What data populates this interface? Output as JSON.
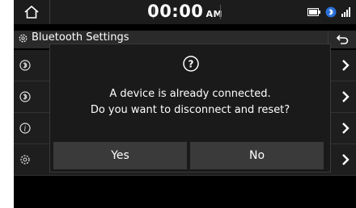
{
  "status": {
    "time": "00:00",
    "ampm": "AM"
  },
  "header": {
    "title": "Bluetooth Settings"
  },
  "dialog": {
    "line1": "A device is already connected.",
    "line2": "Do you want to disconnect and reset?",
    "yes_label": "Yes",
    "no_label": "No"
  },
  "icons": {
    "home": "home-icon",
    "back": "back-arrow-icon",
    "question": "question-circle-icon",
    "row1": "bluetooth-audio-icon",
    "row2": "bluetooth-phone-icon",
    "row3": "info-icon",
    "row4": "gear-icon",
    "arrow": "chevron-right-icon"
  },
  "colors": {
    "background": "#000000",
    "dialog": "#1a1a1a",
    "button": "#3a3a3a",
    "text": "#ffffff"
  }
}
